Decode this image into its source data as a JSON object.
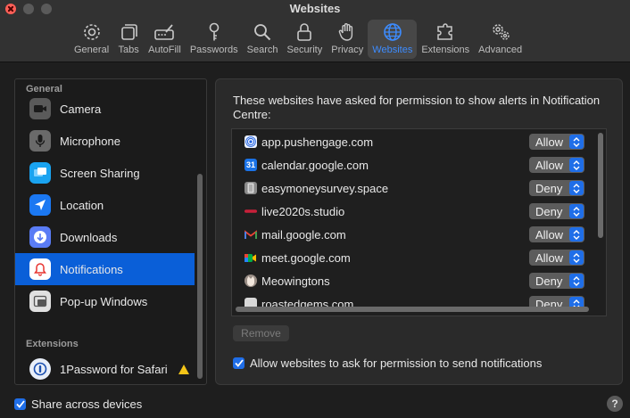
{
  "window": {
    "title": "Websites"
  },
  "toolbar": {
    "tabs": [
      {
        "label": "General",
        "icon": "gear-icon"
      },
      {
        "label": "Tabs",
        "icon": "tabs-icon"
      },
      {
        "label": "AutoFill",
        "icon": "autofill-icon"
      },
      {
        "label": "Passwords",
        "icon": "key-icon"
      },
      {
        "label": "Search",
        "icon": "search-icon"
      },
      {
        "label": "Security",
        "icon": "lock-icon"
      },
      {
        "label": "Privacy",
        "icon": "hand-icon"
      },
      {
        "label": "Websites",
        "icon": "globe-icon",
        "active": true
      },
      {
        "label": "Extensions",
        "icon": "extension-icon"
      },
      {
        "label": "Advanced",
        "icon": "gears-icon"
      }
    ]
  },
  "sidebar": {
    "general_label": "General",
    "items": [
      {
        "label": "Camera",
        "icon": "camera-icon"
      },
      {
        "label": "Microphone",
        "icon": "microphone-icon"
      },
      {
        "label": "Screen Sharing",
        "icon": "screen-sharing-icon"
      },
      {
        "label": "Location",
        "icon": "location-icon"
      },
      {
        "label": "Downloads",
        "icon": "downloads-icon"
      },
      {
        "label": "Notifications",
        "icon": "bell-icon",
        "selected": true
      },
      {
        "label": "Pop-up Windows",
        "icon": "popup-windows-icon"
      }
    ],
    "extensions_label": "Extensions",
    "extensions": [
      {
        "label": "1Password for Safari",
        "icon": "1password-icon",
        "warning_icon": "warning-icon"
      }
    ]
  },
  "panel": {
    "description": "These websites have asked for permission to show alerts in Notification Centre:",
    "websites": [
      {
        "domain": "app.pushengage.com",
        "permission": "Allow"
      },
      {
        "domain": "calendar.google.com",
        "permission": "Allow"
      },
      {
        "domain": "easymoneysurvey.space",
        "permission": "Deny"
      },
      {
        "domain": "live2020s.studio",
        "permission": "Deny"
      },
      {
        "domain": "mail.google.com",
        "permission": "Allow"
      },
      {
        "domain": "meet.google.com",
        "permission": "Allow"
      },
      {
        "domain": "Meowingtons",
        "permission": "Deny"
      },
      {
        "domain": "roastedgems.com",
        "permission": "Deny"
      }
    ],
    "remove_label": "Remove",
    "allow_ask_label": "Allow websites to ask for permission to send notifications",
    "allow_ask_checked": true
  },
  "footer": {
    "share_label": "Share across devices",
    "share_checked": true,
    "help_label": "?"
  },
  "colors": {
    "accent": "#1f6ee8",
    "selection": "#0a5fd8",
    "active_tab_text": "#3d8cff"
  }
}
